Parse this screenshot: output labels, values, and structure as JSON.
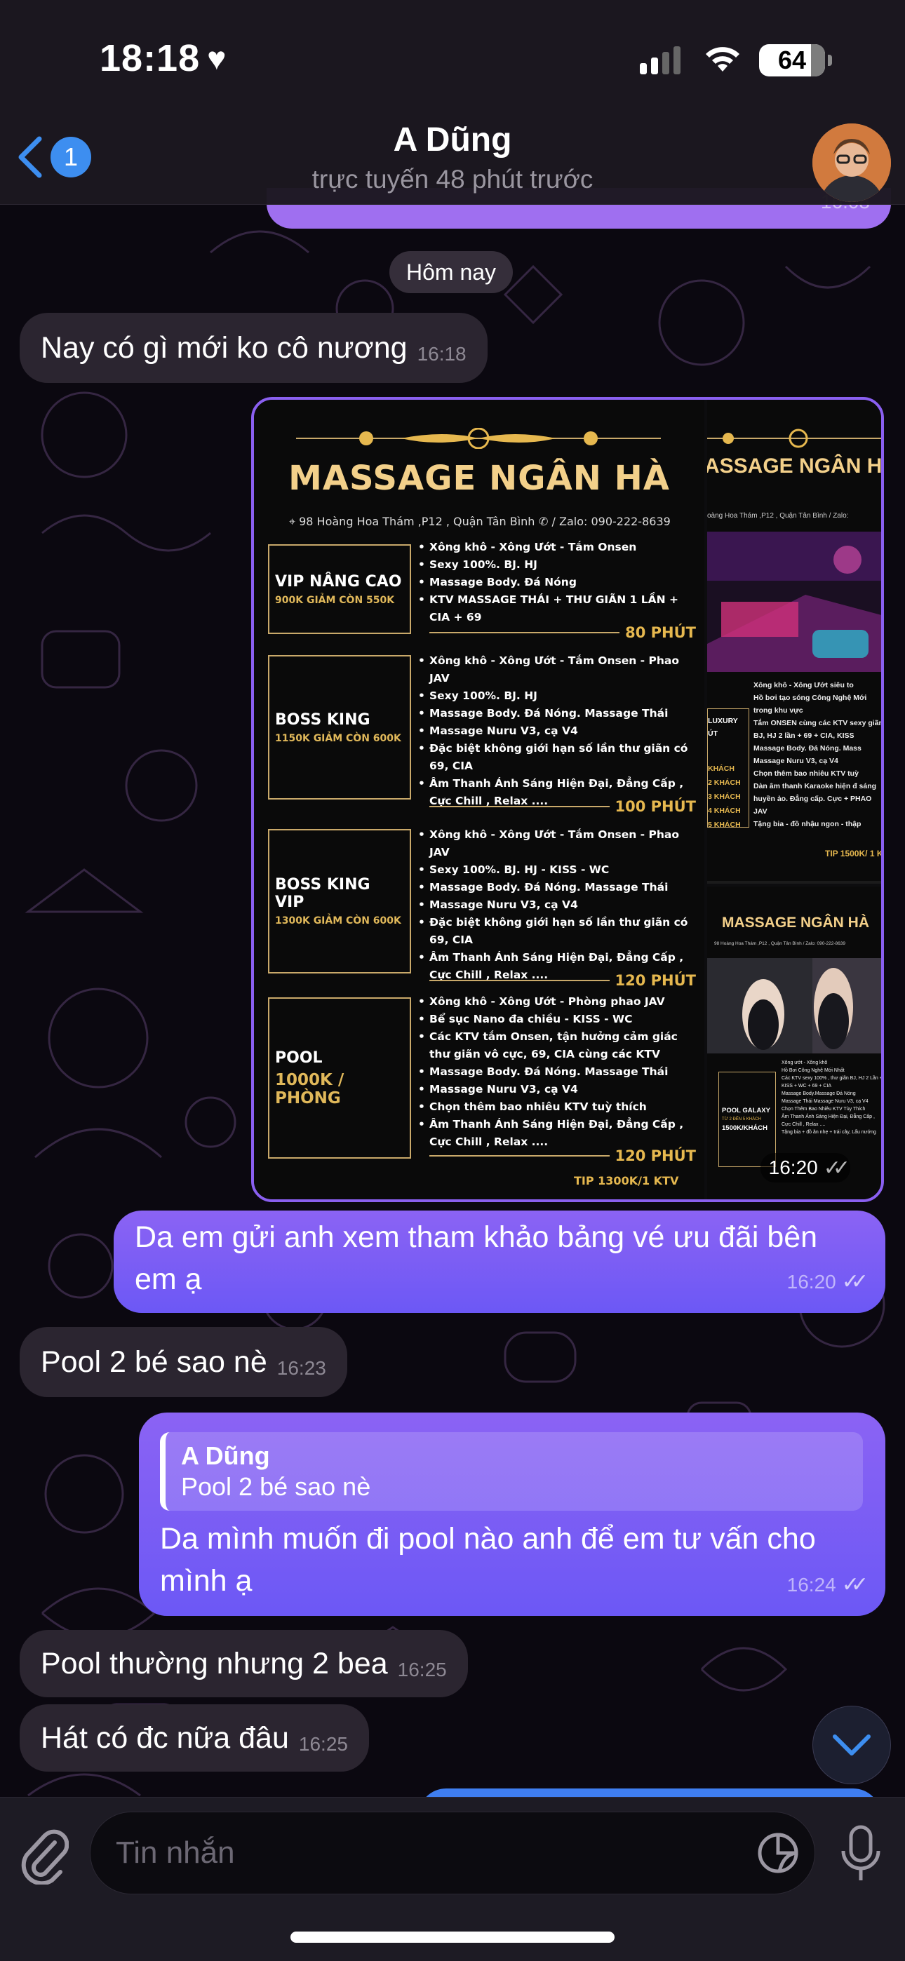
{
  "status_bar": {
    "time": "18:18",
    "battery": "64"
  },
  "header": {
    "unread_count": "1",
    "title": "A Dũng",
    "subtitle": "trực tuyến 48 phút trước"
  },
  "previous_message": {
    "time": "16:08"
  },
  "date_separator": "Hôm nay",
  "messages": [
    {
      "direction": "in",
      "text": "Nay có gì mới ko cô nương",
      "time": "16:18"
    },
    {
      "direction": "out",
      "type": "photo",
      "time": "16:20"
    },
    {
      "direction": "out",
      "text": "Da em gửi anh xem tham khảo bảng vé ưu đãi bên em ạ",
      "time": "16:20"
    },
    {
      "direction": "in",
      "text": "Pool 2 bé sao nè",
      "time": "16:23"
    },
    {
      "direction": "out",
      "reply_to": {
        "name": "A Dũng",
        "text": "Pool 2 bé sao nè"
      },
      "text": "Da mình muốn đi pool nào anh để em tư vấn cho mình ạ",
      "time": "16:24"
    },
    {
      "direction": "in",
      "text": "Pool thường nhưng 2 bea",
      "time": "16:25"
    },
    {
      "direction": "in",
      "text": "Hát có đc nữa đâu",
      "time": "16:25"
    }
  ],
  "poster": {
    "title": "MASSAGE NGÂN HÀ",
    "address": "98 Hoàng Hoa Thám ,P12 , Quận Tân Bình",
    "zalo": "/ Zalo: 090-222-8639",
    "packages": [
      {
        "name": "VIP NÂNG CAO",
        "price": "900K GIẢM CÒN 550K",
        "duration": "80 PHÚT",
        "features": [
          "Xông khô - Xông Ướt - Tắm Onsen",
          "Sexy 100%. BJ. HJ",
          "Massage Body. Đá Nóng",
          "KTV  MASSAGE THÁI + THƯ GIÃN 1 LẦN + CIA + 69"
        ]
      },
      {
        "name": "BOSS KING",
        "price": "1150K GIẢM CÒN 600K",
        "duration": "100 PHÚT",
        "features": [
          "Xông khô - Xông Ướt - Tắm Onsen - Phao JAV",
          "Sexy 100%. BJ. HJ",
          "Massage Body. Đá Nóng. Massage Thái",
          "Massage Nuru V3, cạ V4",
          "Đặc biệt không giới hạn số lần thư giãn có 69, CIA",
          "Âm Thanh Ánh Sáng Hiện Đại, Đẳng Cấp , Cực Chill , Relax ...."
        ]
      },
      {
        "name": "BOSS KING VIP",
        "price": "1300K GIẢM CÒN 600K",
        "duration": "120 PHÚT",
        "features": [
          "Xông khô - Xông Ướt - Tắm Onsen - Phao JAV",
          "Sexy 100%. BJ. HJ - KISS - WC",
          "Massage Body. Đá Nóng. Massage Thái",
          "Massage Nuru V3, cạ V4",
          "Đặc biệt không giới hạn số lần thư giãn có 69, CIA",
          "Âm Thanh Ánh Sáng Hiện Đại, Đẳng Cấp , Cực Chill , Relax ...."
        ]
      },
      {
        "name": "POOL",
        "price": "1000K / PHÒNG",
        "duration": "120 PHÚT",
        "features": [
          "Xông khô - Xông Ướt - Phòng phao JAV",
          "Bể sục Nano đa chiều - KISS - WC",
          "Các KTV tắm Onsen, tận hưởng cảm giác thư giãn vô cực, 69, CIA cùng các KTV",
          "Massage Body. Đá Nóng. Massage Thái",
          "Massage Nuru V3, cạ V4",
          "Chọn thêm bao nhiêu KTV tuỳ thích",
          "Âm Thanh Ánh Sáng Hiện Đại, Đẳng Cấp , Cực Chill , Relax ...."
        ]
      }
    ],
    "tip": "TIP 1300K/1 KTV",
    "side_top": {
      "title": "ASSAGE NGÂN H",
      "address": "oàng Hoa Thám ,P12 , Quận Tân Bình     / Zalo:",
      "label": [
        "LUXURY",
        "ÚT",
        "KHÁCH",
        "2 KHÁCH",
        "3 KHÁCH",
        "4 KHÁCH",
        "5 KHÁCH"
      ],
      "features": [
        "Xông khô - Xông Ướt siêu to",
        "Hồ bơi tạo sóng Công Nghệ Mới trong khu vực",
        "Tắm ONSEN cùng các KTV sexy giãn BJ, HJ 2 lần + 69 + CIA, KISS",
        "Massage Body. Đá Nóng. Mass",
        "Massage Nuru V3, cạ V4",
        "Chọn thêm bao nhiêu KTV tuỳ",
        "Dàn âm thanh Karaoke hiện đ sáng huyền ảo. Đẳng cấp. Cực + PHAO JAV",
        "Tặng bia - đồ nhậu ngon - thập"
      ],
      "tip": "TIP 1500K/ 1 KT"
    },
    "side_bottom": {
      "title": "MASSAGE NGÂN HÀ",
      "address": "98 Hoàng Hoa Thám ,P12 , Quận Tân Bình   / Zalo: 090-222-8639",
      "package": "POOL GALAXY",
      "package_sub": "TỪ 2 ĐẾN 5 KHÁCH",
      "price": "1500K/KHÁCH",
      "features": [
        "Xông ướt - Xông khô",
        "Hồ Bơi Công Nghệ Mới Nhất",
        "Các KTV sexy 100% , thư giãn BJ, HJ 2 Lần + KISS + WC + 69 + CIA",
        "Massage Body.Massage Đá Nóng",
        "Massage Thái Massage Nuru V3, cạ V4",
        "Chọn Thêm Bao Nhiêu KTV Tùy Thích",
        "Âm Thanh Ánh Sáng Hiện Đại, Đẳng Cấp , Cực Chill , Relax ....",
        "Tặng bia + đồ ăn nhẹ + trái cây, Lẩu nướng"
      ]
    }
  },
  "input": {
    "placeholder": "Tin nhắn"
  },
  "colors": {
    "outgoing": "#7a5cf4",
    "incoming": "#2b2530",
    "accent": "#3d8ef0",
    "poster_gold": "#e6b84f"
  }
}
